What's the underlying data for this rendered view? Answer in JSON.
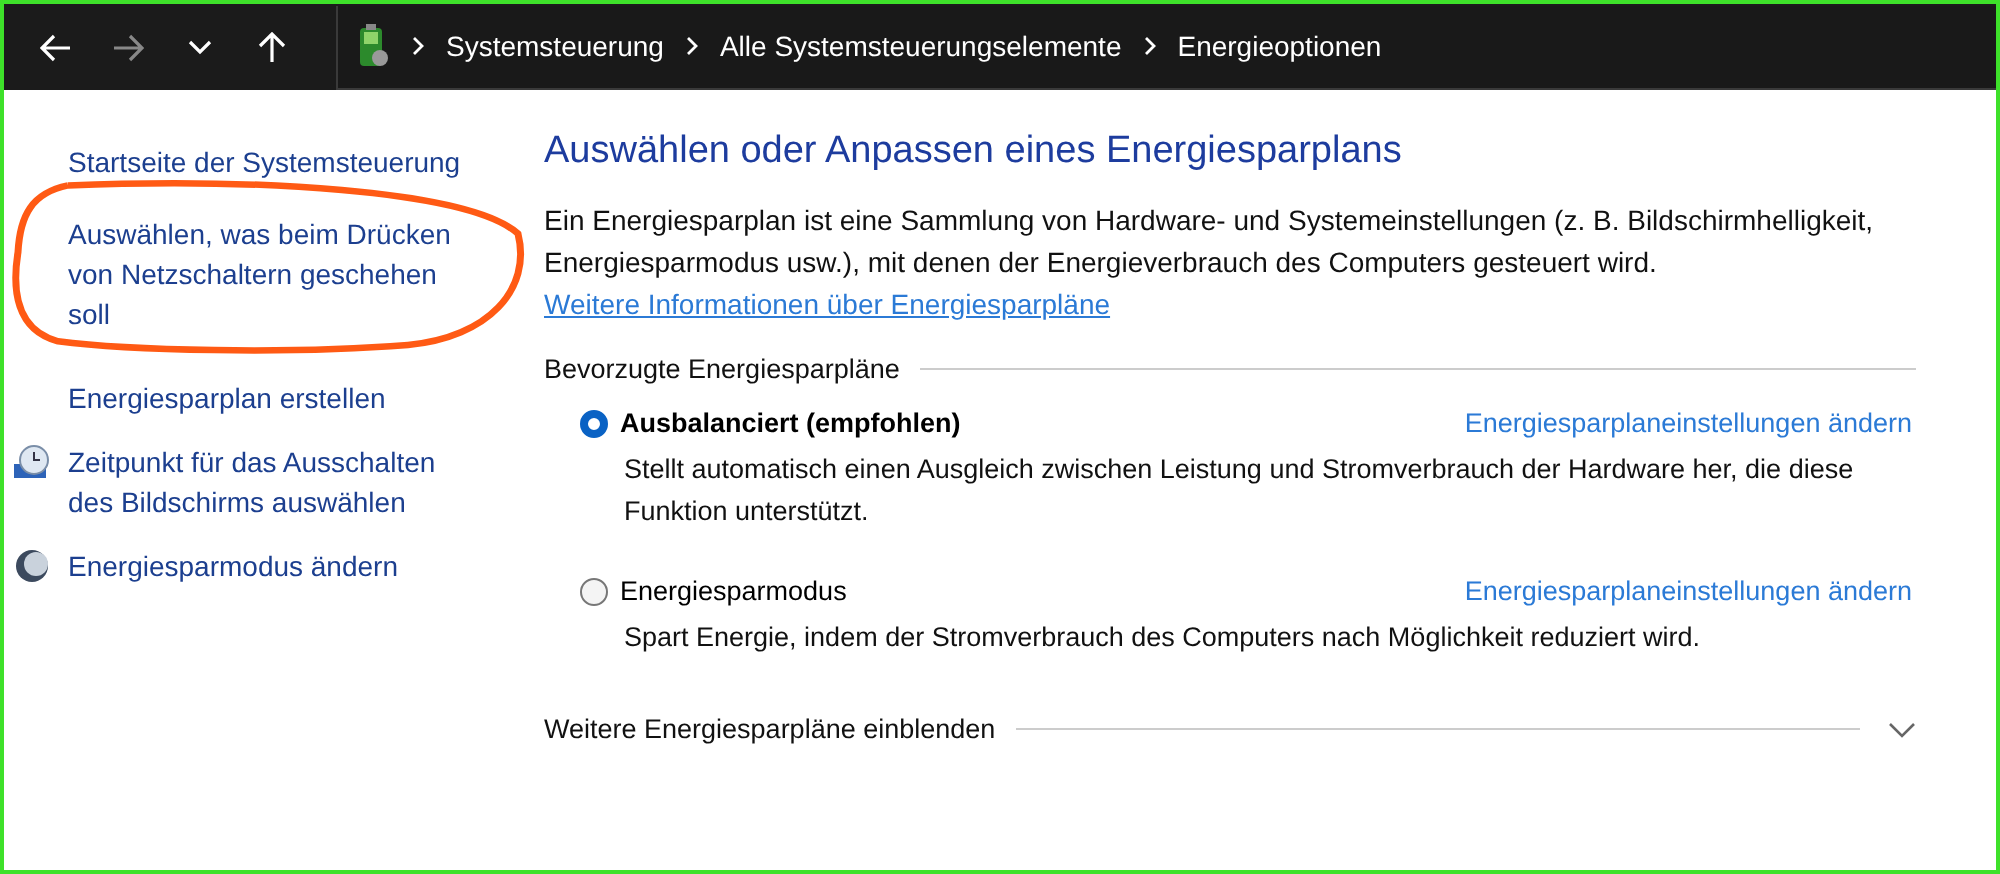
{
  "breadcrumb": [
    "Systemsteuerung",
    "Alle Systemsteuerungselemente",
    "Energieoptionen"
  ],
  "sidebar": {
    "items": [
      {
        "label": "Startseite der Systemsteuerung",
        "kind": "plain",
        "annotated": false
      },
      {
        "label": "Auswählen, was beim Drücken von Netzschaltern geschehen soll",
        "kind": "plain",
        "annotated": true
      },
      {
        "label": "Energiesparplan erstellen",
        "kind": "plain",
        "annotated": false
      },
      {
        "label": "Zeitpunkt für das Ausschalten des Bildschirms auswählen",
        "kind": "clock",
        "annotated": false
      },
      {
        "label": "Energiesparmodus ändern",
        "kind": "moon",
        "annotated": false
      }
    ]
  },
  "main": {
    "title": "Auswählen oder Anpassen eines Energiesparplans",
    "intro": "Ein Energiesparplan ist eine Sammlung von Hardware- und Systemeinstellungen (z. B. Bildschirmhelligkeit, Energiesparmodus usw.), mit denen der Energieverbrauch des Computers gesteuert wird.",
    "intro_link": "Weitere Informationen über Energiesparpläne",
    "section": "Bevorzugte Energiesparpläne",
    "plans": [
      {
        "name": "Ausbalanciert (empfohlen)",
        "selected": true,
        "link": "Energiesparplaneinstellungen ändern",
        "description": "Stellt automatisch einen Ausgleich zwischen Leistung und Stromverbrauch der Hardware her, die diese Funktion unterstützt."
      },
      {
        "name": "Energiesparmodus",
        "selected": false,
        "link": "Energiesparplaneinstellungen ändern",
        "description": "Spart Energie, indem der Stromverbrauch des Computers nach Möglichkeit reduziert wird."
      }
    ],
    "more": "Weitere Energiesparpläne einblenden"
  }
}
